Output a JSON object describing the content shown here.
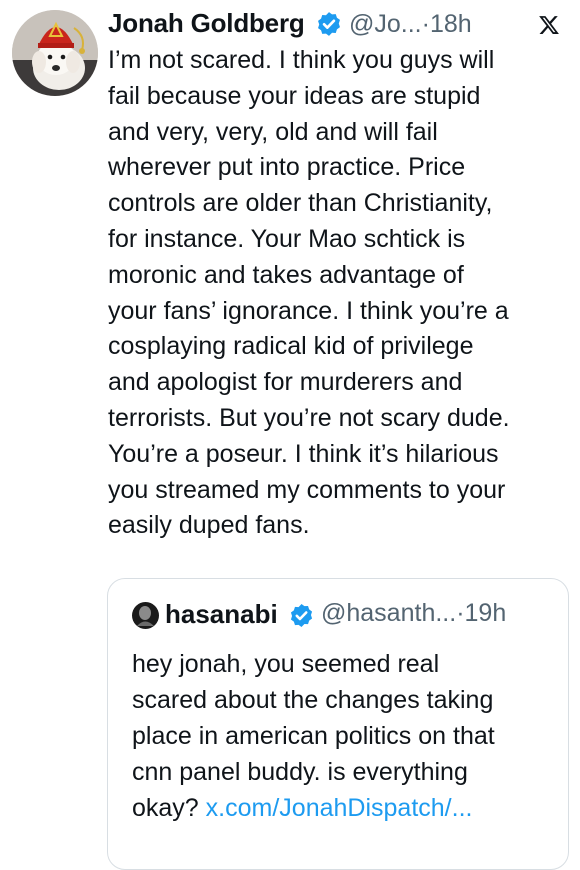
{
  "tweet": {
    "author_name": "Jonah Goldberg",
    "author_handle": "@Jo...",
    "separator": "·",
    "time": "18h",
    "body_lines": [
      "I’m not scared. I think you guys will",
      "fail because your ideas are stupid",
      "and very, very, old and will fail",
      "wherever put into practice. Price",
      "controls are older than Christianity,",
      "for instance. Your Mao schtick is",
      "moronic and takes advantage of",
      "your fans’ ignorance. I think you’re a",
      "cosplaying radical kid of privilege",
      "and apologist for murderers and",
      "terrorists. But you’re not scary dude.",
      "You’re a poseur.  I think it’s hilarious",
      "you streamed my comments to your",
      "easily duped fans."
    ]
  },
  "quoted": {
    "author_name": "hasanabi",
    "author_handle": "@hasanth...",
    "separator": "·",
    "time": "19h",
    "body_lines": [
      "hey jonah, you seemed real",
      "scared about the changes taking",
      "place in american politics on that",
      "cnn panel buddy. is everything"
    ],
    "last_line_text": "okay? ",
    "link": "x.com/JonahDispatch/..."
  },
  "icons": {
    "verified": "verified-badge-icon",
    "x_logo": "x-logo-icon"
  },
  "colors": {
    "verified_blue": "#1d9bf0",
    "handle_gray": "#536471",
    "text": "#0f1419"
  }
}
